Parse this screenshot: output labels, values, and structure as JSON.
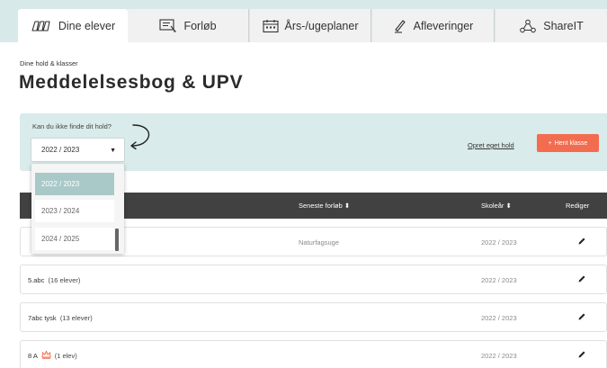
{
  "tabs": [
    {
      "id": "students",
      "label": "Dine elever",
      "icon": "students-icon",
      "active": true
    },
    {
      "id": "courses",
      "label": "Forløb",
      "icon": "board-icon",
      "active": false
    },
    {
      "id": "plans",
      "label": "Års-/ugeplaner",
      "icon": "calendar-icon",
      "active": false
    },
    {
      "id": "assignments",
      "label": "Afleveringer",
      "icon": "pen-icon",
      "active": false
    },
    {
      "id": "shareit",
      "label": "ShareIT",
      "icon": "network-icon",
      "active": false
    }
  ],
  "breadcrumb": "Dine hold & klasser",
  "page_title": "Meddelelsesbog & UPV",
  "filter": {
    "hint": "Kan du ikke finde dit hold?",
    "selected_year": "2022 / 2023",
    "options": [
      "2022 / 2023",
      "2023 / 2024",
      "2024 / 2025"
    ],
    "create_link": "Opret eget hold",
    "fetch_button": "Hent klasse"
  },
  "table": {
    "headers": {
      "latest": "Seneste forløb",
      "year": "Skoleår",
      "edit": "Rediger"
    },
    "rows": [
      {
        "name": "",
        "count": "",
        "latest": "Naturfagsuge",
        "year": "2022 / 2023"
      },
      {
        "name": "5.abc",
        "count": "(16 elever)",
        "latest": "",
        "year": "2022 / 2023"
      },
      {
        "name": "7abc tysk",
        "count": "(13 elever)",
        "latest": "",
        "year": "2022 / 2023"
      },
      {
        "name": "8 A",
        "count": "(1 elev)",
        "latest": "",
        "year": "2022 / 2023",
        "badge_icon": "crown-icon"
      }
    ]
  },
  "colors": {
    "accent": "#f26d4f",
    "panel": "#d9ebea",
    "header": "#414141",
    "selected_option": "#a9c9c8"
  }
}
